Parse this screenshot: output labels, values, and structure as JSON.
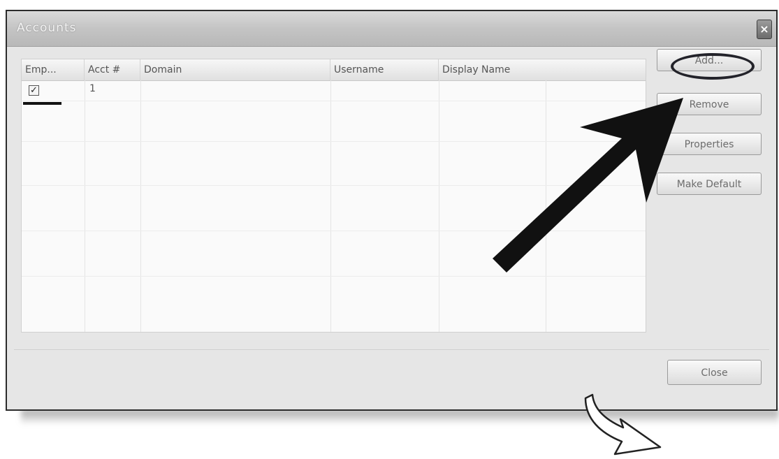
{
  "dialog": {
    "title": "Accounts",
    "close_glyph": "×"
  },
  "list": {
    "columns": [
      "Emp...",
      "Acct #",
      "Domain",
      "Username",
      "Display Name"
    ],
    "rows": [
      {
        "enabled": true,
        "enabled_glyph": "✓",
        "acct": "1",
        "domain": "",
        "username": "",
        "display_name": ""
      }
    ]
  },
  "buttons": {
    "add": "Add...",
    "remove": "Remove",
    "properties": "Properties",
    "make_default": "Make Default",
    "close": "Close"
  },
  "annotations": {
    "arrow_color": "#111111",
    "circle_color": "#23232a",
    "curved_arrow_color": "#ffffff"
  }
}
